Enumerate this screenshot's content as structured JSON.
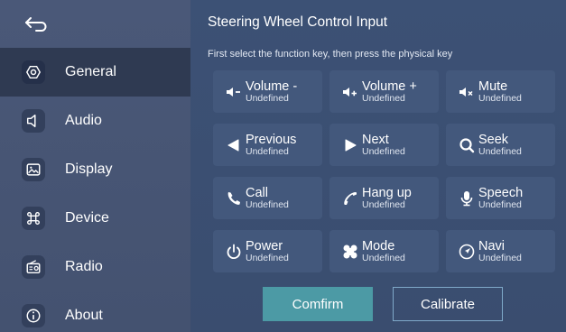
{
  "sidebar": {
    "items": [
      {
        "label": "General",
        "icon": "settings-icon",
        "active": true
      },
      {
        "label": "Audio",
        "icon": "speaker-icon",
        "active": false
      },
      {
        "label": "Display",
        "icon": "image-icon",
        "active": false
      },
      {
        "label": "Device",
        "icon": "command-icon",
        "active": false
      },
      {
        "label": "Radio",
        "icon": "radio-icon",
        "active": false
      },
      {
        "label": "About",
        "icon": "info-icon",
        "active": false
      }
    ]
  },
  "main": {
    "title": "Steering Wheel Control Input",
    "subtitle": "First select the function key, then press the physical key",
    "keys": [
      {
        "label": "Volume -",
        "sub": "Undefined",
        "icon": "volume-down-icon"
      },
      {
        "label": "Volume +",
        "sub": "Undefined",
        "icon": "volume-up-icon"
      },
      {
        "label": "Mute",
        "sub": "Undefined",
        "icon": "mute-icon"
      },
      {
        "label": "Previous",
        "sub": "Undefined",
        "icon": "previous-icon"
      },
      {
        "label": "Next",
        "sub": "Undefined",
        "icon": "next-icon"
      },
      {
        "label": "Seek",
        "sub": "Undefined",
        "icon": "seek-icon"
      },
      {
        "label": "Call",
        "sub": "Undefined",
        "icon": "phone-icon"
      },
      {
        "label": "Hang up",
        "sub": "Undefined",
        "icon": "hang-up-icon"
      },
      {
        "label": "Speech",
        "sub": "Undefined",
        "icon": "microphone-icon"
      },
      {
        "label": "Power",
        "sub": "Undefined",
        "icon": "power-icon"
      },
      {
        "label": "Mode",
        "sub": "Undefined",
        "icon": "mode-icon"
      },
      {
        "label": "Navi",
        "sub": "Undefined",
        "icon": "navigation-icon"
      }
    ],
    "buttons": {
      "confirm": "Comfirm",
      "calibrate": "Calibrate"
    }
  },
  "colors": {
    "accent": "#4c9aa5",
    "sidebar_active": "#2f3a52",
    "key_bg": "#43587c"
  }
}
